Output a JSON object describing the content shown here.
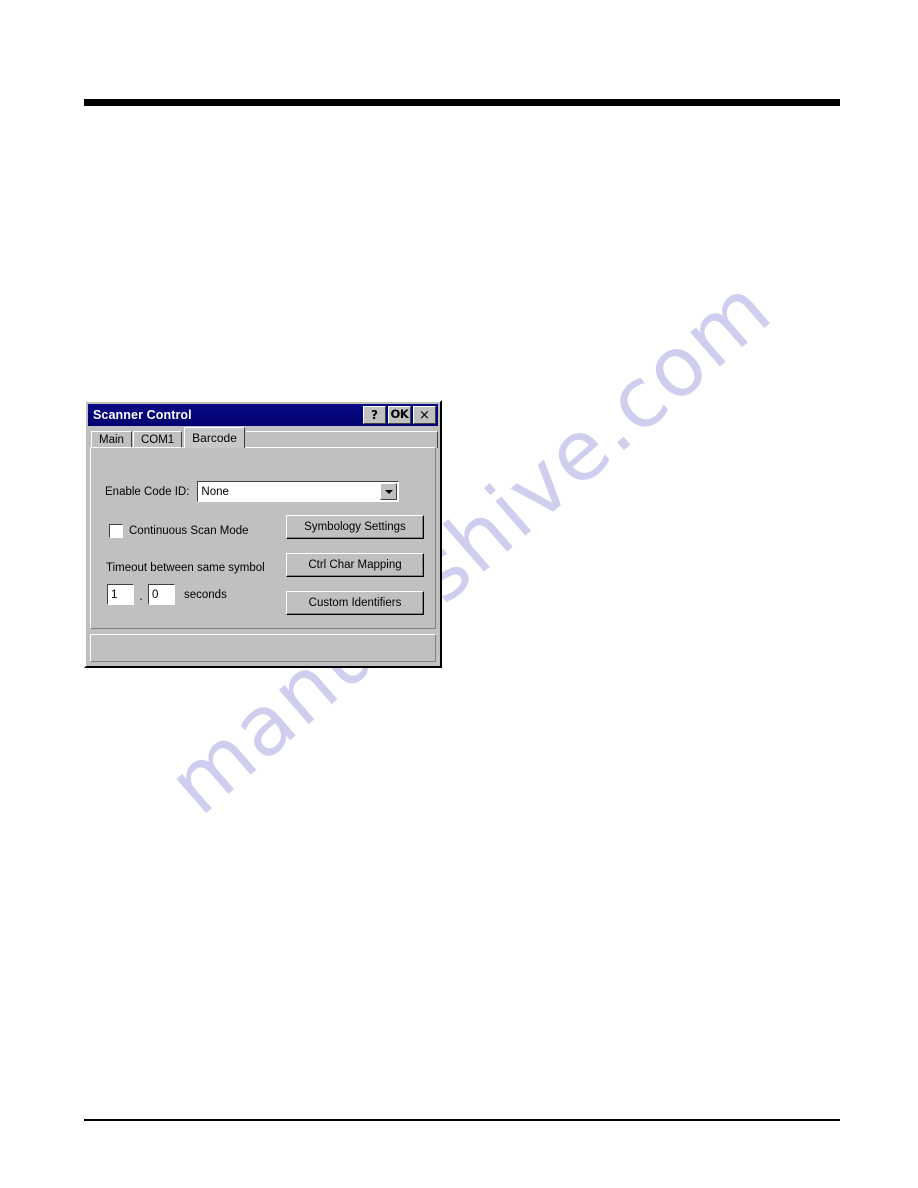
{
  "page": {
    "header_text": "",
    "footer_text": ""
  },
  "watermark": {
    "text": "manualshive.com",
    "color": "#cdccee"
  },
  "dialog": {
    "title": "Scanner Control",
    "titlebar_color": "#00007e",
    "face_color": "#c0c0c0",
    "titlebar_buttons": [
      {
        "name": "help",
        "label": "?"
      },
      {
        "name": "ok",
        "label": "OK"
      },
      {
        "name": "close",
        "label": "×"
      }
    ],
    "tabs": [
      {
        "label": "Main",
        "active": false
      },
      {
        "label": "COM1",
        "active": false
      },
      {
        "label": "Barcode",
        "active": true
      }
    ],
    "fields": {
      "code_id_label": "Enable Code ID:",
      "code_id_value": "None",
      "continuous_scan_label": "Continuous Scan Mode",
      "continuous_scan_checked": false,
      "timeout_label": "Timeout between same symbol",
      "timeout_whole": "1",
      "timeout_decimal_separator": ".",
      "timeout_fraction": "0",
      "seconds_label": "seconds"
    },
    "buttons": [
      {
        "label": "Symbology Settings"
      },
      {
        "label": "Ctrl Char Mapping"
      },
      {
        "label": "Custom Identifiers"
      }
    ],
    "status_text": ""
  }
}
